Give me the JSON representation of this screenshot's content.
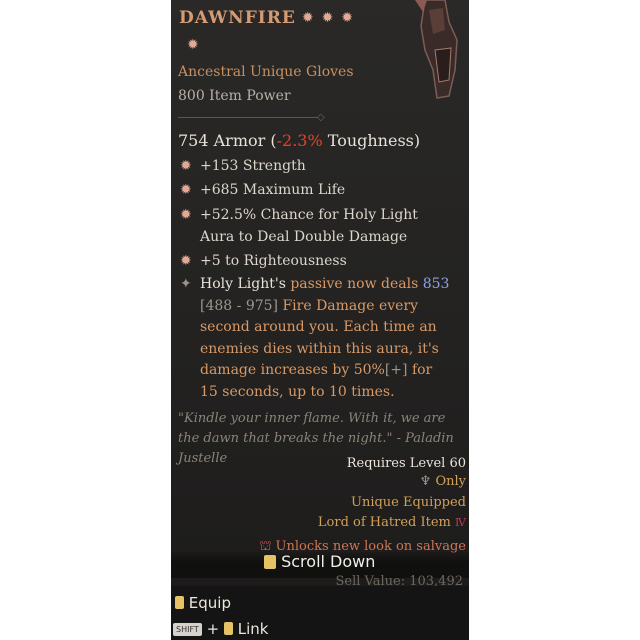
{
  "item": {
    "name": "DAWNFIRE",
    "type": "Ancestral Unique Gloves",
    "power": "800 Item Power",
    "armor_value": "754 Armor (",
    "armor_delta": "-2.3%",
    "armor_stat": " Toughness)",
    "affixes": [
      "+153 Strength",
      "+685 Maximum Life",
      "+52.5% Chance for Holy Light Aura to Deal Double Damage",
      "+5 to Righteousness"
    ],
    "legendary": {
      "p1": "Holy Light's ",
      "p2": "passive now deals ",
      "p3": "853",
      "p4": "[488 - 975]",
      "p5": " Fire Damage every second around you. Each time an enemies dies within this aura, it's damage increases by 50%",
      "p6": "[+]",
      "p7": " for 15 seconds, up to 10 times."
    },
    "flavor": "\"Kindle your inner flame. With it, we are the dawn that breaks the night.\" - Paladin Justelle",
    "requires": "Requires Level 60",
    "only": "Only",
    "unique_equipped": "Unique Equipped",
    "lord": "Lord of Hatred Item",
    "unlocks": "Unlocks new look on salvage",
    "sell": "Sell Value: 103,492"
  },
  "controls": {
    "scroll": "Scroll Down",
    "equip": "Equip",
    "shift": "SHIFT",
    "plus": "+",
    "link": "Link"
  }
}
